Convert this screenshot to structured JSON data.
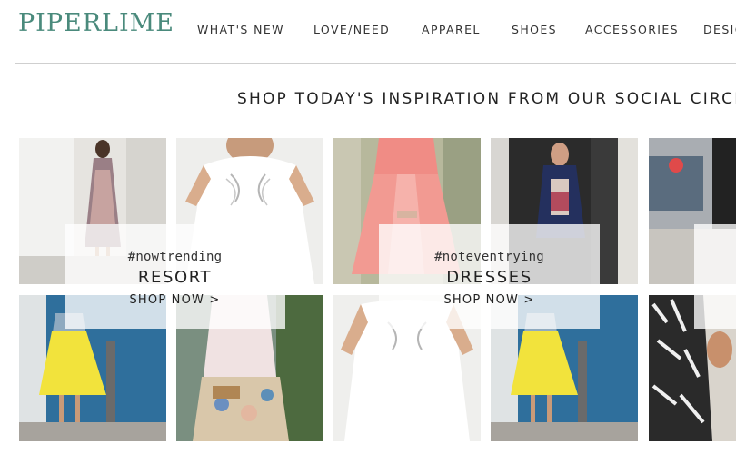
{
  "brand": {
    "name": "PIPERLIME",
    "color": "#4a8a7c"
  },
  "nav": [
    "WHAT'S NEW",
    "LOVE/NEED",
    "APPAREL",
    "SHOES",
    "ACCESSORIES",
    "DESIG"
  ],
  "headline": "SHOP TODAY'S INSPIRATION FROM OUR SOCIAL CIRCLES",
  "promos": [
    {
      "tag": "#nowtrending",
      "category": "RESORT",
      "cta": "SHOP NOW >"
    },
    {
      "tag": "#noteventrying",
      "category": "DRESSES",
      "cta": "SHOP NOW >"
    }
  ]
}
